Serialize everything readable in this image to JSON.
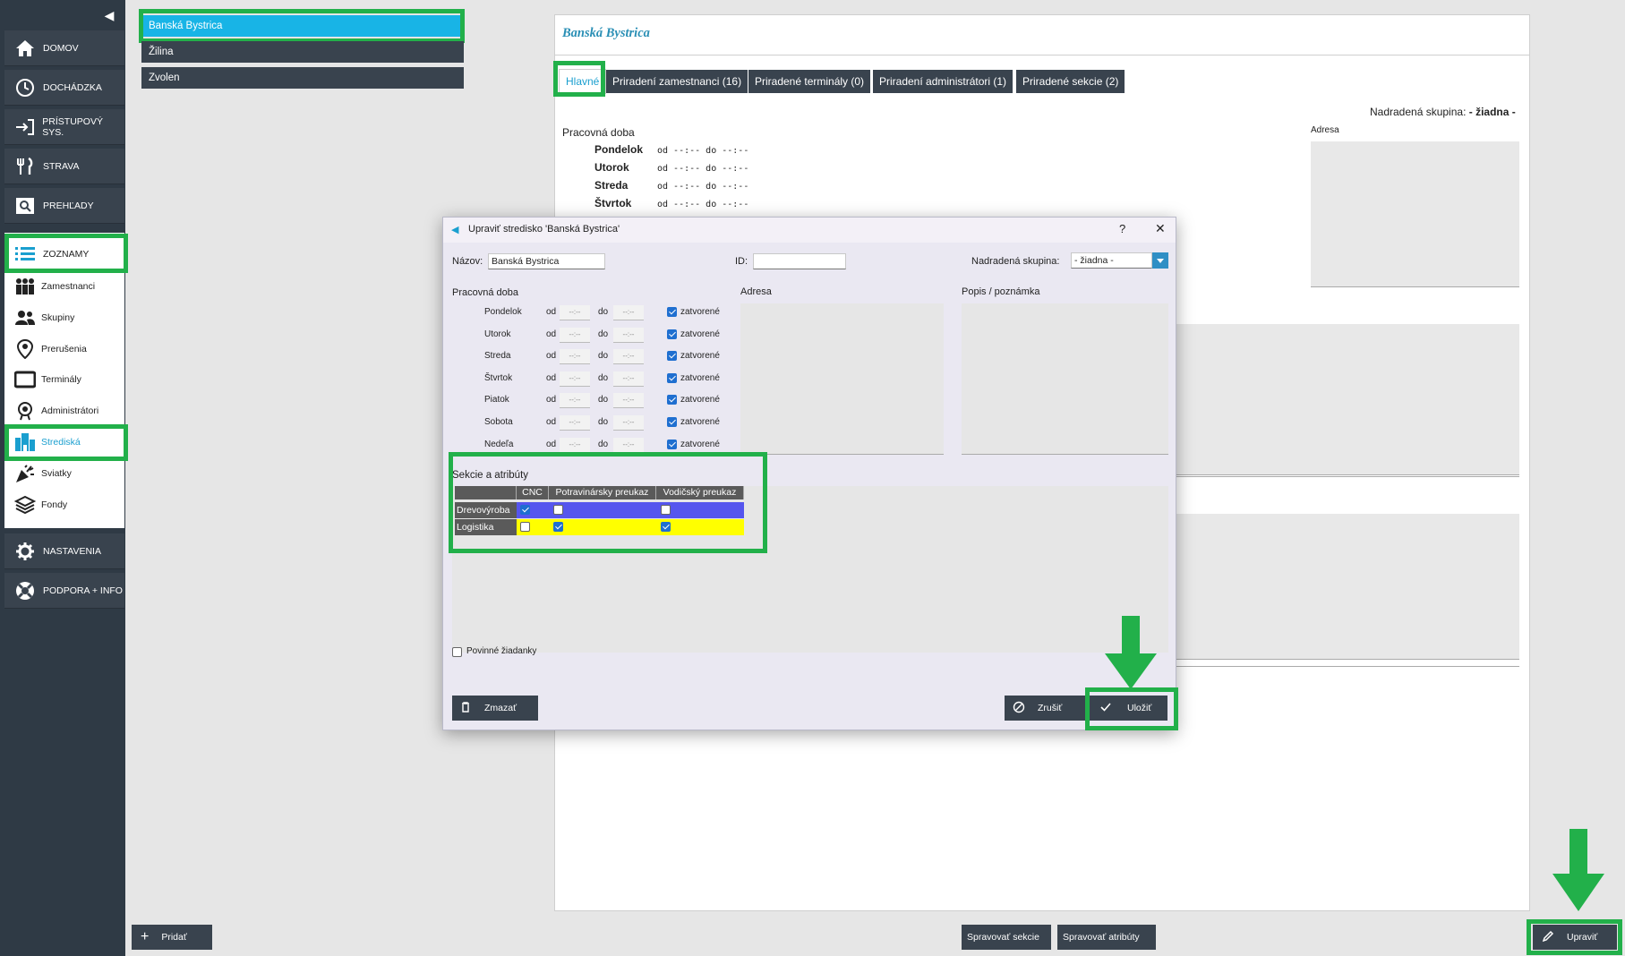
{
  "sidebar": {
    "collapse_icon": "chevron-left-icon",
    "main_items": [
      {
        "label": "DOMOV",
        "icon": "home-icon"
      },
      {
        "label": "DOCHÁDZKA",
        "icon": "clock-icon"
      },
      {
        "label": "PRÍSTUPOVÝ SYS.",
        "icon": "login-icon"
      },
      {
        "label": "STRAVA",
        "icon": "cutlery-icon"
      },
      {
        "label": "PREHĽADY",
        "icon": "search-icon"
      },
      {
        "label": "ZOZNAMY",
        "icon": "list-icon"
      }
    ],
    "sub_items": [
      {
        "label": "Zamestnanci",
        "icon": "people-icon"
      },
      {
        "label": "Skupiny",
        "icon": "group-icon"
      },
      {
        "label": "Prerušenia",
        "icon": "pin-icon"
      },
      {
        "label": "Terminály",
        "icon": "terminal-icon"
      },
      {
        "label": "Administrátori",
        "icon": "admin-icon"
      },
      {
        "label": "Strediská",
        "icon": "building-icon"
      },
      {
        "label": "Sviatky",
        "icon": "party-icon"
      },
      {
        "label": "Fondy",
        "icon": "layers-icon"
      }
    ],
    "bottom_items": [
      {
        "label": "NASTAVENIA",
        "icon": "gear-icon"
      },
      {
        "label": "PODPORA + INFO",
        "icon": "lifebuoy-icon"
      }
    ]
  },
  "list": {
    "items": [
      "Banská Bystrica",
      "Žilina",
      "Zvolen"
    ],
    "add_label": "Pridať"
  },
  "detail": {
    "title": "Banská Bystrica",
    "tabs": [
      "Hlavné",
      "Priradení zamestnanci (16)",
      "Priradené terminály (0)",
      "Priradení administrátori (1)",
      "Priradené sekcie (2)"
    ],
    "parent_label": "Nadradená skupina:",
    "parent_value": "- žiadna -",
    "work_hours_label": "Pracovná doba",
    "address_label": "Adresa",
    "days": [
      {
        "day": "Pondelok",
        "text": "od --:-- do --:--"
      },
      {
        "day": "Utorok",
        "text": "od --:-- do --:--"
      },
      {
        "day": "Streda",
        "text": "od --:-- do --:--"
      },
      {
        "day": "Štvrtok",
        "text": "od --:-- do --:--"
      }
    ]
  },
  "bottom": {
    "manage_sections": "Spravovať sekcie",
    "manage_attributes": "Spravovať atribúty",
    "edit": "Upraviť"
  },
  "dialog": {
    "title": "Upraviť stredisko 'Banská Bystrica'",
    "help": "?",
    "close": "✕",
    "name_label": "Názov:",
    "name_value": "Banská Bystrica",
    "id_label": "ID:",
    "id_value": "",
    "parent_label": "Nadradená skupina:",
    "parent_value": "- žiadna -",
    "work_hours_label": "Pracovná doba",
    "address_label": "Adresa",
    "note_label": "Popis / poznámka",
    "od": "od",
    "do": "do",
    "time_placeholder": "--:--",
    "closed_label": "zatvorené",
    "days": [
      "Pondelok",
      "Utorok",
      "Streda",
      "Štvrtok",
      "Piatok",
      "Sobota",
      "Nedeľa"
    ],
    "sections_label": "Sekcie a atribúty",
    "attr_columns": [
      "CNC",
      "Potravinársky preukaz",
      "Vodičský preukaz"
    ],
    "attr_rows": [
      {
        "name": "Drevovýroba",
        "values": [
          true,
          false,
          false
        ],
        "color": "#5555ee"
      },
      {
        "name": "Logistika",
        "values": [
          false,
          true,
          true
        ],
        "color": "#ffff00"
      }
    ],
    "mandatory_requests_label": "Povinné žiadanky",
    "delete_label": "Zmazať",
    "cancel_label": "Zrušiť",
    "save_label": "Uložiť"
  },
  "colors": {
    "highlight": "#22b04a",
    "accent": "#18b4e6",
    "dark": "#39434e"
  }
}
